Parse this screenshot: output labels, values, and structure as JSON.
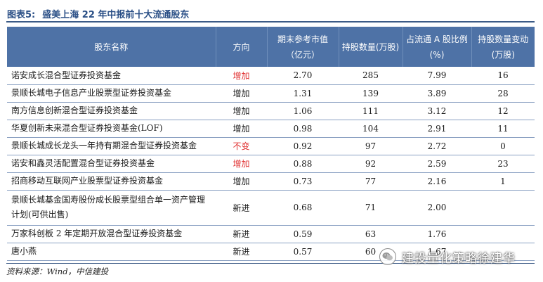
{
  "figure": {
    "label": "图表5:",
    "title": "盛美上海 22 年中报前十大流通股东"
  },
  "table": {
    "headers": [
      "股东名称",
      "方向",
      "期末参考市值（亿元）",
      "持股数量(万股)",
      "占流通 A 股比例(%)",
      "持股数量变动(万股)"
    ],
    "rows": [
      {
        "name": "诺安成长混合型证券投资基金",
        "direction": "增加",
        "value": "2.70",
        "shares": "285",
        "ratio": "7.99",
        "change": "16"
      },
      {
        "name": "景顺长城电子信息产业股票型证券投资基金",
        "direction": "增加",
        "value": "1.31",
        "shares": "139",
        "ratio": "3.89",
        "change": "28"
      },
      {
        "name": "南方信息创新混合型证券投资基金",
        "direction": "增加",
        "value": "1.06",
        "shares": "111",
        "ratio": "3.12",
        "change": "12"
      },
      {
        "name": "华夏创新未来混合型证券投资基金(LOF)",
        "direction": "增加",
        "value": "0.98",
        "shares": "104",
        "ratio": "2.91",
        "change": "11"
      },
      {
        "name": "景顺长城成长龙头一年持有期混合型证券投资基金",
        "direction": "不变",
        "value": "0.92",
        "shares": "97",
        "ratio": "2.72",
        "change": "0"
      },
      {
        "name": "诺安和鑫灵活配置混合型证券投资基金",
        "direction": "增加",
        "value": "0.88",
        "shares": "92",
        "ratio": "2.59",
        "change": "23"
      },
      {
        "name": "招商移动互联网产业股票型证券投资基金",
        "direction": "增加",
        "value": "0.73",
        "shares": "77",
        "ratio": "2.16",
        "change": "1"
      },
      {
        "name": "景顺长城基金国寿股份成长股票型组合单一资产管理计划(可供出售)",
        "direction": "新进",
        "value": "0.68",
        "shares": "71",
        "ratio": "2.00",
        "change": ""
      },
      {
        "name": "万家科创板 2 年定期开放混合型证券投资基金",
        "direction": "新进",
        "value": "0.59",
        "shares": "63",
        "ratio": "1.76",
        "change": ""
      },
      {
        "name": "唐小燕",
        "direction": "新进",
        "value": "0.57",
        "shares": "60",
        "ratio": "1.67",
        "change": ""
      }
    ],
    "direction_colors": {
      "增加_first": "#e03030",
      "不变": "#e03030",
      "default": "#1a1a1a"
    }
  },
  "footer": {
    "source": "资料来源：Wind，中信建投"
  },
  "watermark": {
    "text": "建投量化策略徐建华",
    "icon": "wechat-icon"
  }
}
